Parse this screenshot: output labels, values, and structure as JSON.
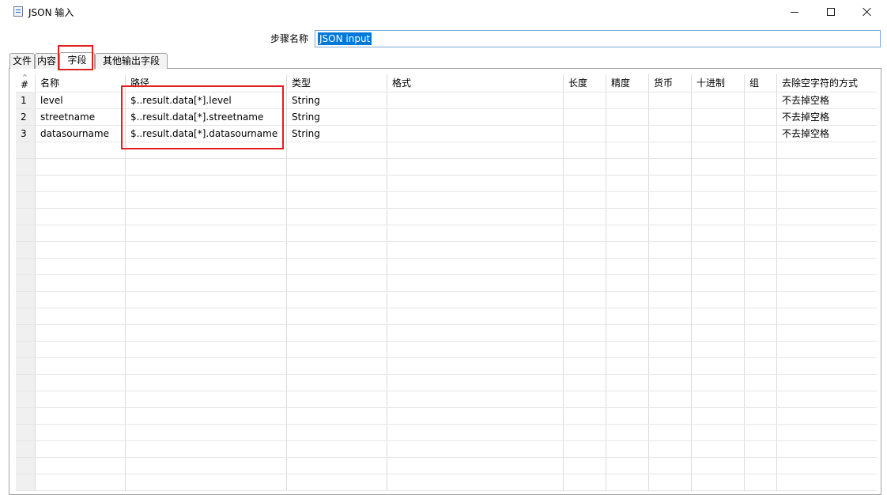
{
  "window": {
    "title": "JSON 输入"
  },
  "step": {
    "label": "步骤名称",
    "value": "JSON input"
  },
  "tabs": [
    {
      "label": "文件",
      "active": false
    },
    {
      "label": "内容",
      "active": false
    },
    {
      "label": "字段",
      "active": true
    },
    {
      "label": "其他输出字段",
      "active": false
    }
  ],
  "table": {
    "columns": [
      "#",
      "名称",
      "路径",
      "类型",
      "格式",
      "长度",
      "精度",
      "货币",
      "十进制",
      "组",
      "去除空字符的方式"
    ],
    "rows": [
      {
        "num": "1",
        "name": "level",
        "path": "$..result.data[*].level",
        "type": "String",
        "format": "",
        "length": "",
        "precision": "",
        "currency": "",
        "decimal": "",
        "group": "",
        "trim": "不去掉空格"
      },
      {
        "num": "2",
        "name": "streetname",
        "path": "$..result.data[*].streetname",
        "type": "String",
        "format": "",
        "length": "",
        "precision": "",
        "currency": "",
        "decimal": "",
        "group": "",
        "trim": "不去掉空格"
      },
      {
        "num": "3",
        "name": "datasourname",
        "path": "$..result.data[*].datasourname",
        "type": "String",
        "format": "",
        "length": "",
        "precision": "",
        "currency": "",
        "decimal": "",
        "group": "",
        "trim": "不去掉空格"
      }
    ]
  },
  "colors": {
    "selection": "#0078d7",
    "highlight": "#e02020"
  }
}
